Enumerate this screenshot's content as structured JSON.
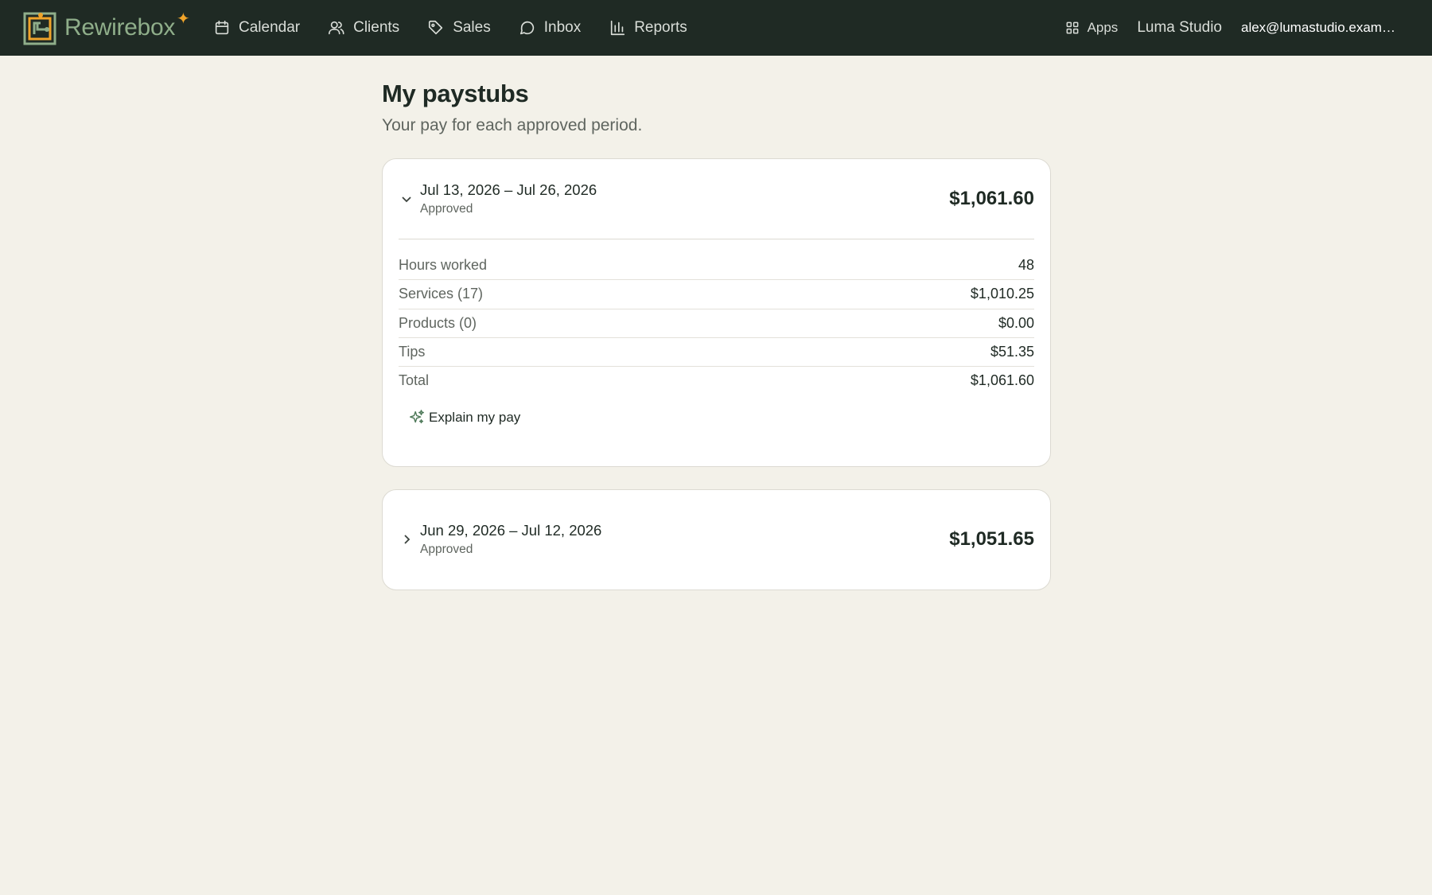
{
  "brand": {
    "name": "Rewirebox",
    "accent": "#f0a42a",
    "color": "#8fae8a"
  },
  "nav": [
    {
      "label": "Calendar",
      "icon": "calendar-icon"
    },
    {
      "label": "Clients",
      "icon": "users-icon"
    },
    {
      "label": "Sales",
      "icon": "tag-icon"
    },
    {
      "label": "Inbox",
      "icon": "chat-icon"
    },
    {
      "label": "Reports",
      "icon": "bar-chart-icon"
    }
  ],
  "header_right": {
    "apps_label": "Apps",
    "studio": "Luma Studio",
    "email": "alex@lumastudio.example.com"
  },
  "page": {
    "title": "My paystubs",
    "subtitle": "Your pay for each approved period."
  },
  "paystubs": [
    {
      "period": "Jul 13, 2026 – Jul 26, 2026",
      "status": "Approved",
      "total": "$1,061.60",
      "expanded": true,
      "rows": [
        {
          "label": "Hours worked",
          "value": "48"
        },
        {
          "label": "Services (17)",
          "value": "$1,010.25"
        },
        {
          "label": "Products (0)",
          "value": "$0.00"
        },
        {
          "label": "Tips",
          "value": "$51.35"
        },
        {
          "label": "Total",
          "value": "$1,061.60"
        }
      ],
      "explain_label": "Explain my pay"
    },
    {
      "period": "Jun 29, 2026 – Jul 12, 2026",
      "status": "Approved",
      "total": "$1,051.65",
      "expanded": false
    }
  ],
  "colors": {
    "topbar": "#1f2a24",
    "background": "#f3f1e9",
    "card": "#ffffff"
  }
}
